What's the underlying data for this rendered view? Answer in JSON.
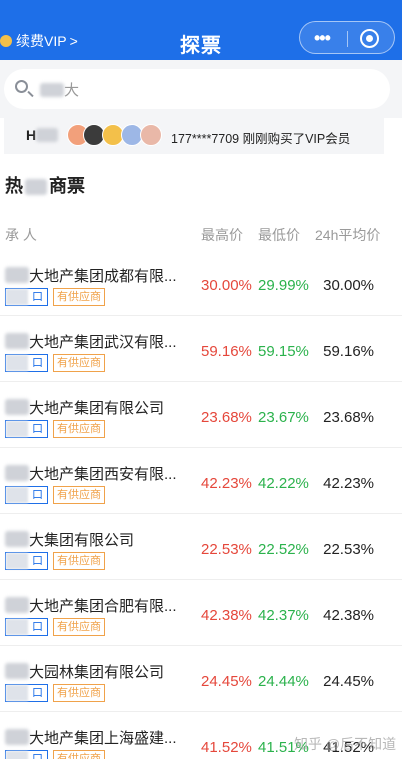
{
  "header": {
    "vip_label": "续费VIP",
    "vip_chevron": ">",
    "title": "探票",
    "menu_icon": "more-dots-icon",
    "close_icon": "target-icon"
  },
  "search": {
    "placeholder": "大"
  },
  "notice": {
    "label": "H",
    "message": "177****7709 刚刚购买了VIP会员",
    "avatar_colors": [
      "#f2a07b",
      "#3b3b3b",
      "#f3c04a",
      "#9db7e6",
      "#e9b8a8"
    ]
  },
  "section": {
    "title_left": "热",
    "title_right": "商票"
  },
  "table": {
    "headers": {
      "name": "承 人",
      "high": "最高价",
      "low": "最低价",
      "avg": "24h平均价"
    },
    "rows": [
      {
        "name": "大地产集团成都有限...",
        "tag1": "口",
        "tag2": "有供应商",
        "high": "30.00%",
        "low": "29.99%",
        "avg": "30.00%"
      },
      {
        "name": "大地产集团武汉有限...",
        "tag1": "口",
        "tag2": "有供应商",
        "high": "59.16%",
        "low": "59.15%",
        "avg": "59.16%"
      },
      {
        "name": "大地产集团有限公司",
        "tag1": "口",
        "tag2": "有供应商",
        "high": "23.68%",
        "low": "23.67%",
        "avg": "23.68%"
      },
      {
        "name": "大地产集团西安有限...",
        "tag1": "口",
        "tag2": "有供应商",
        "high": "42.23%",
        "low": "42.22%",
        "avg": "42.23%"
      },
      {
        "name": "大集团有限公司",
        "tag1": "口",
        "tag2": "有供应商",
        "high": "22.53%",
        "low": "22.52%",
        "avg": "22.53%"
      },
      {
        "name": "大地产集团合肥有限...",
        "tag1": "口",
        "tag2": "有供应商",
        "high": "42.38%",
        "low": "42.37%",
        "avg": "42.38%"
      },
      {
        "name": "大园林集团有限公司",
        "tag1": "口",
        "tag2": "有供应商",
        "high": "24.45%",
        "low": "24.44%",
        "avg": "24.45%"
      },
      {
        "name": "大地产集团上海盛建...",
        "tag1": "口",
        "tag2": "有供应商",
        "high": "41.52%",
        "low": "41.51%",
        "avg": "41.52%"
      }
    ]
  },
  "watermark": "知乎 @后不知道"
}
